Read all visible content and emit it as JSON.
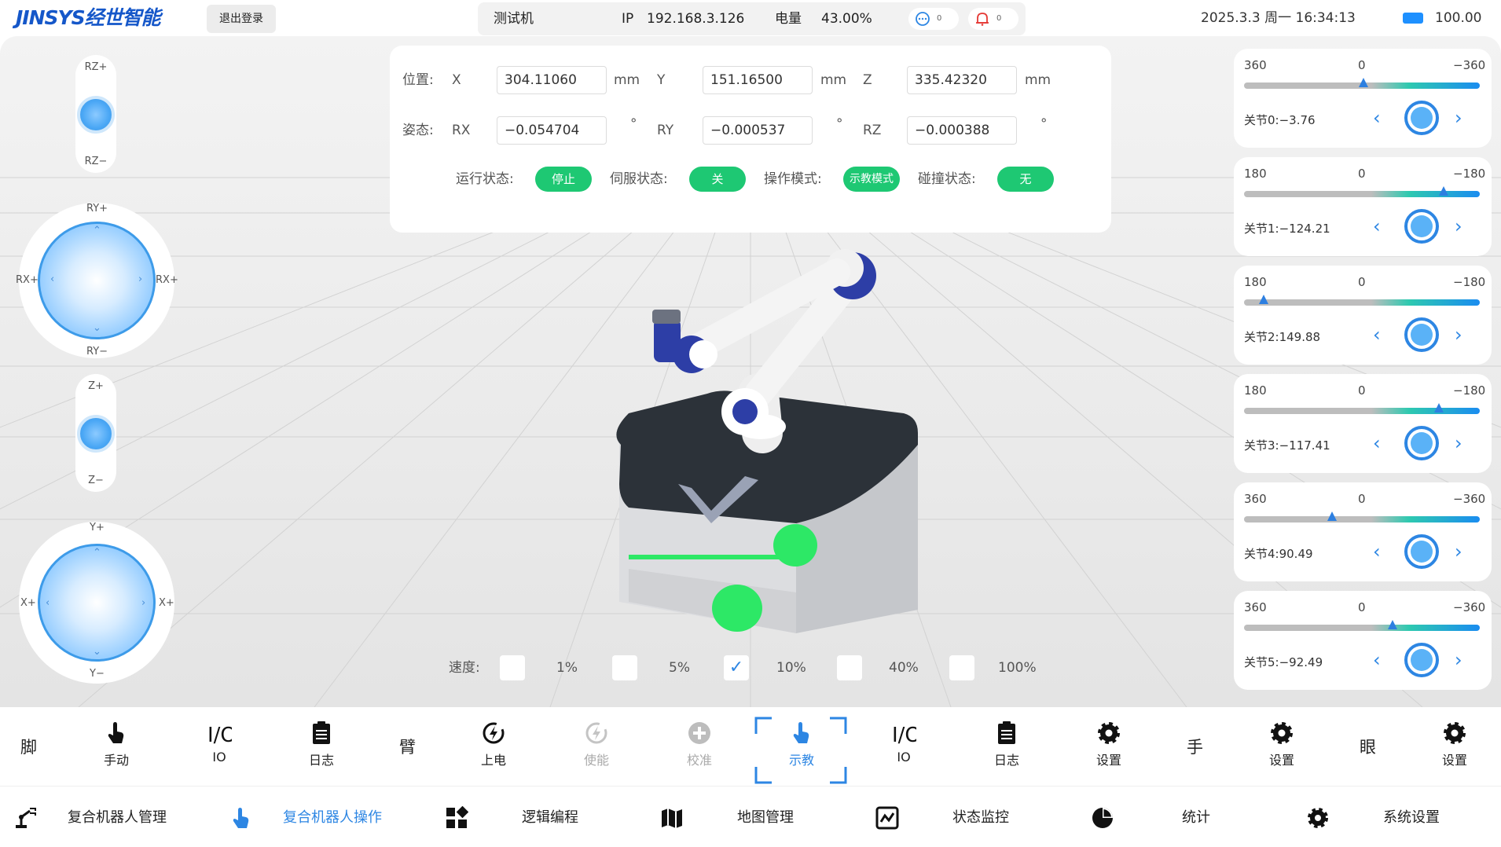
{
  "header": {
    "logo": "JINSYS经世智能",
    "logout": "退出登录",
    "device_name": "测试机",
    "ip_label": "IP",
    "ip": "192.168.3.126",
    "power_label": "电量",
    "power": "43.00%",
    "messages": "0",
    "alarms": "0",
    "datetime": "2025.3.3 周一 16:34:13",
    "battery": "100.00"
  },
  "pose": {
    "position_label": "位置:",
    "attitude_label": "姿态:",
    "x_label": "X",
    "x": "304.11060",
    "x_unit": "mm",
    "y_label": "Y",
    "y": "151.16500",
    "y_unit": "mm",
    "z_label": "Z",
    "z": "335.42320",
    "z_unit": "mm",
    "rx_label": "RX",
    "rx": "−0.054704",
    "rx_unit": "°",
    "ry_label": "RY",
    "ry": "−0.000537",
    "ry_unit": "°",
    "rz_label": "RZ",
    "rz": "−0.000388",
    "rz_unit": "°"
  },
  "status": {
    "run_label": "运行状态:",
    "run": "停止",
    "servo_label": "伺服状态:",
    "servo": "关",
    "mode_label": "操作模式:",
    "mode": "示教模式",
    "collision_label": "碰撞状态:",
    "collision": "无"
  },
  "jog": {
    "rz_plus": "RZ+",
    "rz_minus": "RZ−",
    "ry_plus": "RY+",
    "ry_minus": "RY−",
    "rx_plus_left": "RX+",
    "rx_plus_right": "RX+",
    "z_plus": "Z+",
    "z_minus": "Z−",
    "y_plus": "Y+",
    "y_minus": "Y−",
    "x_plus_left": "X+",
    "x_plus_right": "X+"
  },
  "joints": [
    {
      "min": "360",
      "mid": "0",
      "max": "−360",
      "label": "关节0:−3.76",
      "value": -3.76,
      "range": 360
    },
    {
      "min": "180",
      "mid": "0",
      "max": "−180",
      "label": "关节1:−124.21",
      "value": -124.21,
      "range": 180
    },
    {
      "min": "180",
      "mid": "0",
      "max": "−180",
      "label": "关节2:149.88",
      "value": 149.88,
      "range": 180
    },
    {
      "min": "180",
      "mid": "0",
      "max": "−180",
      "label": "关节3:−117.41",
      "value": -117.41,
      "range": 180
    },
    {
      "min": "360",
      "mid": "0",
      "max": "−360",
      "label": "关节4:90.49",
      "value": 90.49,
      "range": 360
    },
    {
      "min": "360",
      "mid": "0",
      "max": "−360",
      "label": "关节5:−92.49",
      "value": -92.49,
      "range": 360
    }
  ],
  "speed": {
    "label": "速度:",
    "options": [
      "1%",
      "5%",
      "10%",
      "40%",
      "100%"
    ],
    "selected": "10%"
  },
  "toolbar": {
    "foot": "脚",
    "manual": "手动",
    "io1": "IO",
    "log1": "日志",
    "arm": "臂",
    "power_on": "上电",
    "enable": "使能",
    "calibrate": "校准",
    "teach": "示教",
    "io2": "IO",
    "log2": "日志",
    "settings1": "设置",
    "hand": "手",
    "settings2": "设置",
    "eye": "眼",
    "settings3": "设置"
  },
  "nav": {
    "robot_mgmt": "复合机器人管理",
    "robot_ops": "复合机器人操作",
    "logic_prog": "逻辑编程",
    "map_mgmt": "地图管理",
    "status_monitor": "状态监控",
    "statistics": "统计",
    "system_settings": "系统设置"
  },
  "colors": {
    "brand": "#1557c9",
    "accent": "#2d86e3",
    "status_green": "#1ec873",
    "robot_blue": "#2d3ea6"
  }
}
